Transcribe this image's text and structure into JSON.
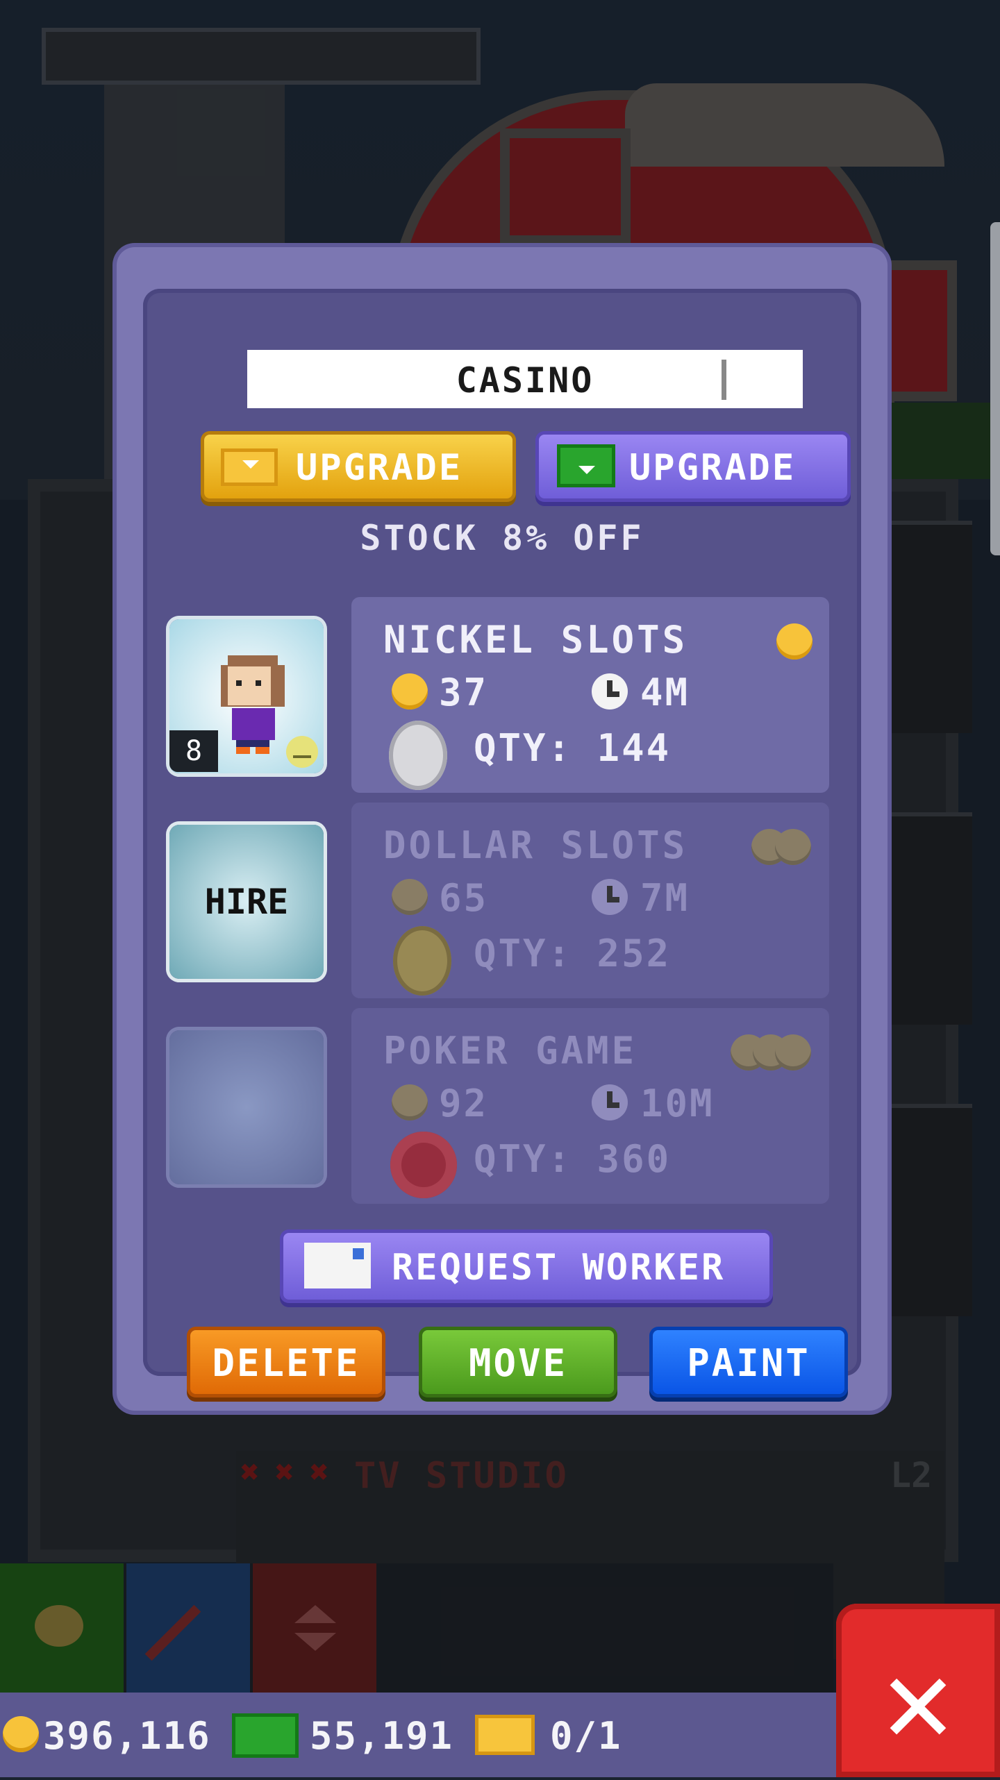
{
  "dialog": {
    "floor_name": "CASINO",
    "upgrade_coin_label": "UPGRADE",
    "upgrade_bux_label": "UPGRADE",
    "discount_text": "STOCK 8% OFF",
    "worker_level": "8",
    "hire_label": "HIRE",
    "stocks": [
      {
        "name": "NICKEL SLOTS",
        "price": "37",
        "time": "4M",
        "qty_label": "QTY: 144",
        "enabled": true
      },
      {
        "name": "DOLLAR SLOTS",
        "price": "65",
        "time": "7M",
        "qty_label": "QTY: 252",
        "enabled": false
      },
      {
        "name": "POKER GAME",
        "price": "92",
        "time": "10M",
        "qty_label": "QTY: 360",
        "enabled": false
      }
    ],
    "request_worker_label": "REQUEST WORKER",
    "delete_label": "DELETE",
    "move_label": "MOVE",
    "paint_label": "PAINT"
  },
  "background": {
    "floor_name": "TV STUDIO",
    "floor_level": "L2"
  },
  "currency": {
    "coins": "396,116",
    "bux": "55,191",
    "tickets": "0/1"
  },
  "colors": {
    "dialog": "#7c77b2",
    "upgrade_gold": "#f0b624",
    "upgrade_purple": "#8a77ea",
    "delete": "#f08a16",
    "move": "#5fb02a",
    "paint": "#1a6cf5",
    "close": "#e22b2b"
  },
  "icons": {
    "coin": "coin-icon",
    "bux": "bux-icon",
    "ticket": "ticket-icon",
    "clock": "clock-icon",
    "mood": "happy-face-icon",
    "close": "close-x-icon"
  }
}
